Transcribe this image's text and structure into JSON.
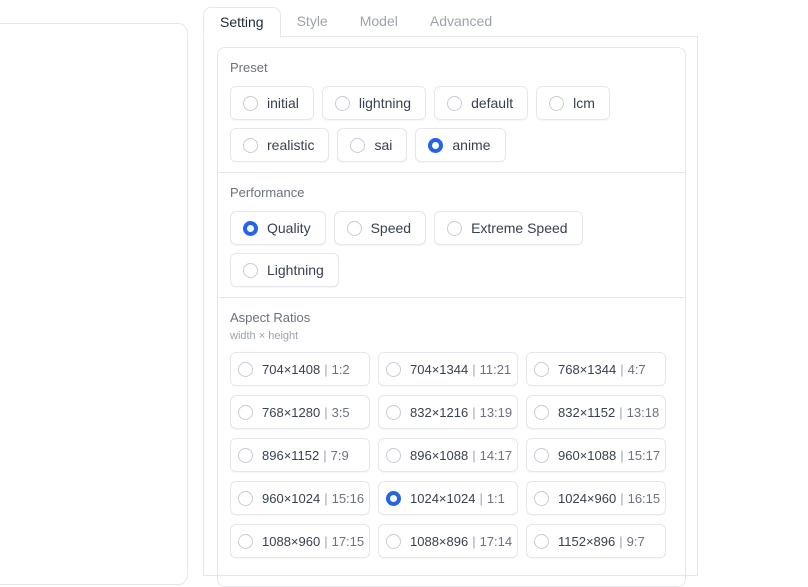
{
  "tabs": [
    "Setting",
    "Style",
    "Model",
    "Advanced"
  ],
  "active_tab": "Setting",
  "preset": {
    "label": "Preset",
    "options": [
      "initial",
      "lightning",
      "default",
      "lcm",
      "realistic",
      "sai",
      "anime"
    ],
    "selected": "anime"
  },
  "performance": {
    "label": "Performance",
    "options": [
      "Quality",
      "Speed",
      "Extreme Speed",
      "Lightning"
    ],
    "selected": "Quality"
  },
  "aspect_ratios": {
    "label": "Aspect Ratios",
    "info": "width × height",
    "separator": "|",
    "options": [
      {
        "dims": "704×1408",
        "ratio": "1:2"
      },
      {
        "dims": "704×1344",
        "ratio": "11:21"
      },
      {
        "dims": "768×1344",
        "ratio": "4:7"
      },
      {
        "dims": "768×1280",
        "ratio": "3:5"
      },
      {
        "dims": "832×1216",
        "ratio": "13:19"
      },
      {
        "dims": "832×1152",
        "ratio": "13:18"
      },
      {
        "dims": "896×1152",
        "ratio": "7:9"
      },
      {
        "dims": "896×1088",
        "ratio": "14:17"
      },
      {
        "dims": "960×1088",
        "ratio": "15:17"
      },
      {
        "dims": "960×1024",
        "ratio": "15:16"
      },
      {
        "dims": "1024×1024",
        "ratio": "1:1"
      },
      {
        "dims": "1024×960",
        "ratio": "16:15"
      },
      {
        "dims": "1088×960",
        "ratio": "17:15"
      },
      {
        "dims": "1088×896",
        "ratio": "17:14"
      },
      {
        "dims": "1152×896",
        "ratio": "9:7"
      }
    ],
    "selected": "1024×1024"
  },
  "colors": {
    "accent": "#2563eb",
    "border": "#e5e7eb"
  }
}
